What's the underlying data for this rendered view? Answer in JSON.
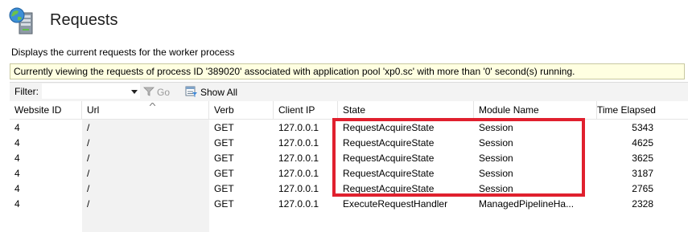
{
  "header": {
    "title": "Requests",
    "icon": "server-globe-icon"
  },
  "description": "Displays the current requests for the worker process",
  "info_bar": {
    "text": "Currently viewing the requests of process ID '389020' associated with application pool 'xp0.sc' with more than '0' second(s) running."
  },
  "filter_bar": {
    "label": "Filter:",
    "value": "",
    "go_label": "Go",
    "show_all_label": "Show All"
  },
  "grid": {
    "columns": [
      "Website ID",
      "Url",
      "Verb",
      "Client IP",
      "State",
      "Module Name",
      "Time Elapsed"
    ],
    "rows": [
      [
        "4",
        "/",
        "GET",
        "127.0.0.1",
        "RequestAcquireState",
        "Session",
        "5343"
      ],
      [
        "4",
        "/",
        "GET",
        "127.0.0.1",
        "RequestAcquireState",
        "Session",
        "4625"
      ],
      [
        "4",
        "/",
        "GET",
        "127.0.0.1",
        "RequestAcquireState",
        "Session",
        "3625"
      ],
      [
        "4",
        "/",
        "GET",
        "127.0.0.1",
        "RequestAcquireState",
        "Session",
        "3187"
      ],
      [
        "4",
        "/",
        "GET",
        "127.0.0.1",
        "RequestAcquireState",
        "Session",
        "2765"
      ],
      [
        "4",
        "/",
        "GET",
        "127.0.0.1",
        "ExecuteRequestHandler",
        "ManagedPipelineHa...",
        "2328"
      ]
    ]
  },
  "colors": {
    "highlight": "#e0202e",
    "info_bg": "#ffffe1"
  }
}
